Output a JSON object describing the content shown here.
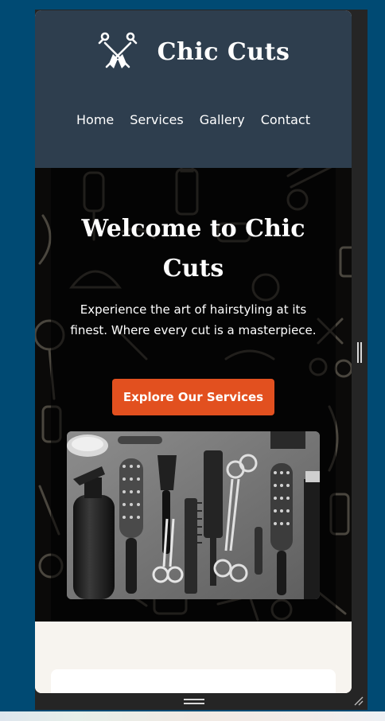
{
  "site": {
    "brand_name": "Chic Cuts",
    "logo_icon": "crossed-scissors-icon"
  },
  "nav": {
    "items": [
      {
        "label": "Home"
      },
      {
        "label": "Services"
      },
      {
        "label": "Gallery"
      },
      {
        "label": "Contact"
      }
    ]
  },
  "hero": {
    "title": "Welcome to Chic Cuts",
    "subtitle": "Experience the art of hairstyling at its finest. Where every cut is a masterpiece.",
    "cta_label": "Explore Our Services",
    "image_subject": "barber tools flat-lay (combs, brushes, scissors, spray bottle) in black and white"
  },
  "colors": {
    "header_bg": "#2e3e4e",
    "accent": "#e2501f",
    "page_bg": "#004a73",
    "section_bg": "#f7f4ef"
  }
}
